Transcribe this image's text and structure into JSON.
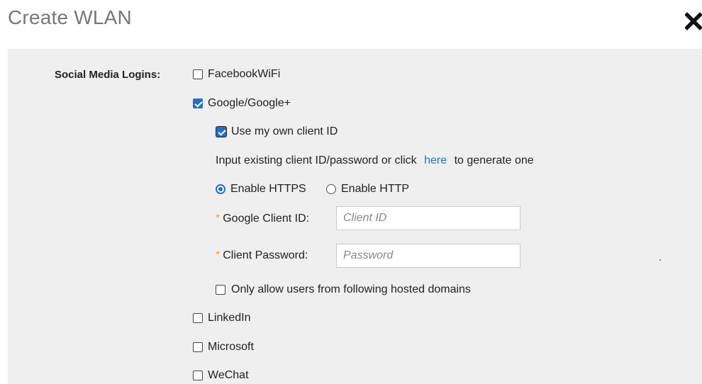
{
  "dialog": {
    "title": "Create WLAN",
    "close_icon": "close-x-icon"
  },
  "social": {
    "section_label": "Social Media Logins:",
    "facebook": {
      "label": "FacebookWiFi",
      "checked": false
    },
    "google": {
      "label": "Google/Google+",
      "checked": true,
      "own_client_id": {
        "label": "Use my own client ID",
        "checked": true
      },
      "hint": {
        "before": "Input existing client ID/password or click",
        "link": "here",
        "after": "to generate one"
      },
      "protocol": {
        "https_label": "Enable HTTPS",
        "http_label": "Enable HTTP",
        "selected": "Enable HTTPS"
      },
      "client_id": {
        "required_mark": "*",
        "label": "Google Client ID:",
        "value": "",
        "placeholder": "Client ID"
      },
      "client_password": {
        "required_mark": "*",
        "label": "Client Password:",
        "value": "",
        "placeholder": "Password"
      },
      "hosted_domains": {
        "label": "Only allow users from following hosted domains",
        "checked": false
      }
    },
    "linkedin": {
      "label": "LinkedIn",
      "checked": false
    },
    "microsoft": {
      "label": "Microsoft",
      "checked": false
    },
    "wechat": {
      "label": "WeChat",
      "checked": false
    }
  },
  "colors": {
    "accent": "#1f6fd1",
    "link": "#2671c9",
    "required": "#f0a13a",
    "panel_bg": "#efefef",
    "title": "#777777"
  }
}
